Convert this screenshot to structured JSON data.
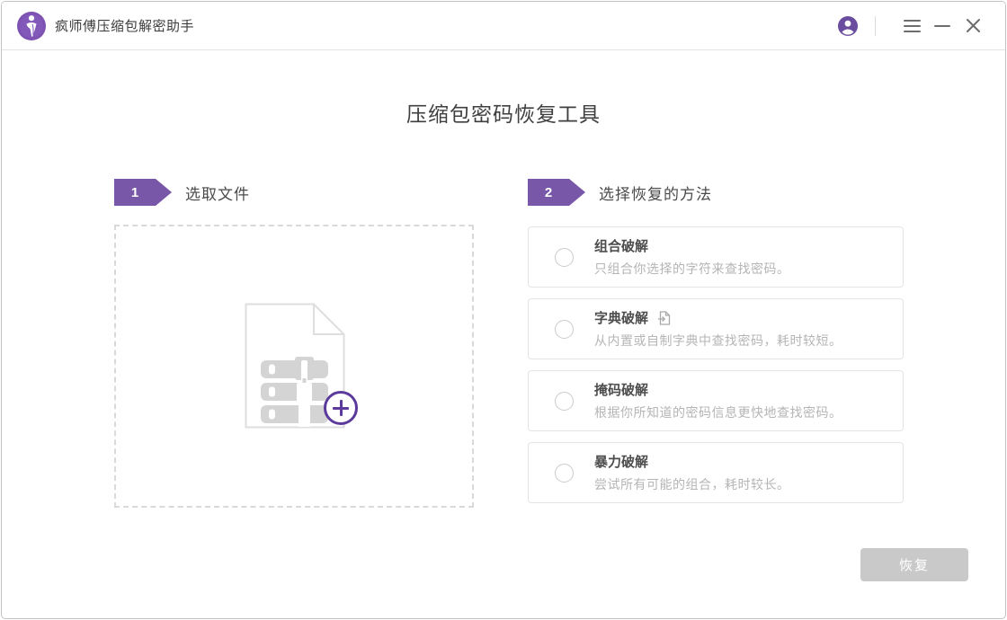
{
  "titlebar": {
    "app_title": "疯师傅压缩包解密助手",
    "icons": {
      "logo": "brand-logo",
      "account": "user-account",
      "menu": "hamburger-menu",
      "minimize": "minimize-window",
      "close": "close-window"
    }
  },
  "main": {
    "page_title": "压缩包密码恢复工具",
    "steps": [
      {
        "number": "1",
        "label": "选取文件"
      },
      {
        "number": "2",
        "label": "选择恢复的方法"
      }
    ],
    "dropzone": {
      "icons": {
        "file": "zip-archive-file",
        "add": "plus-add-file"
      }
    },
    "methods": [
      {
        "title": "组合破解",
        "description": "只组合你选择的字符来查找密码。"
      },
      {
        "title": "字典破解",
        "description": "从内置或自制字典中查找密码，耗时较短。",
        "title_icon": "import-dictionary-file"
      },
      {
        "title": "掩码破解",
        "description": "根据你所知道的密码信息更快地查找密码。"
      },
      {
        "title": "暴力破解",
        "description": "尝试所有可能的组合，耗时较长。"
      }
    ],
    "recover_button": {
      "label": "恢复",
      "enabled": false
    }
  },
  "colors": {
    "brand_purple": "#7857a8",
    "logo_purple": "#7d52b3",
    "accent_purple": "#5b3a9b",
    "card_border": "#e4e4e4",
    "dashed_border": "#d9d9d9",
    "disabled_button_bg": "#c9c9c9",
    "title_text": "#3f3f3f",
    "muted_text": "#b5b5b5"
  }
}
